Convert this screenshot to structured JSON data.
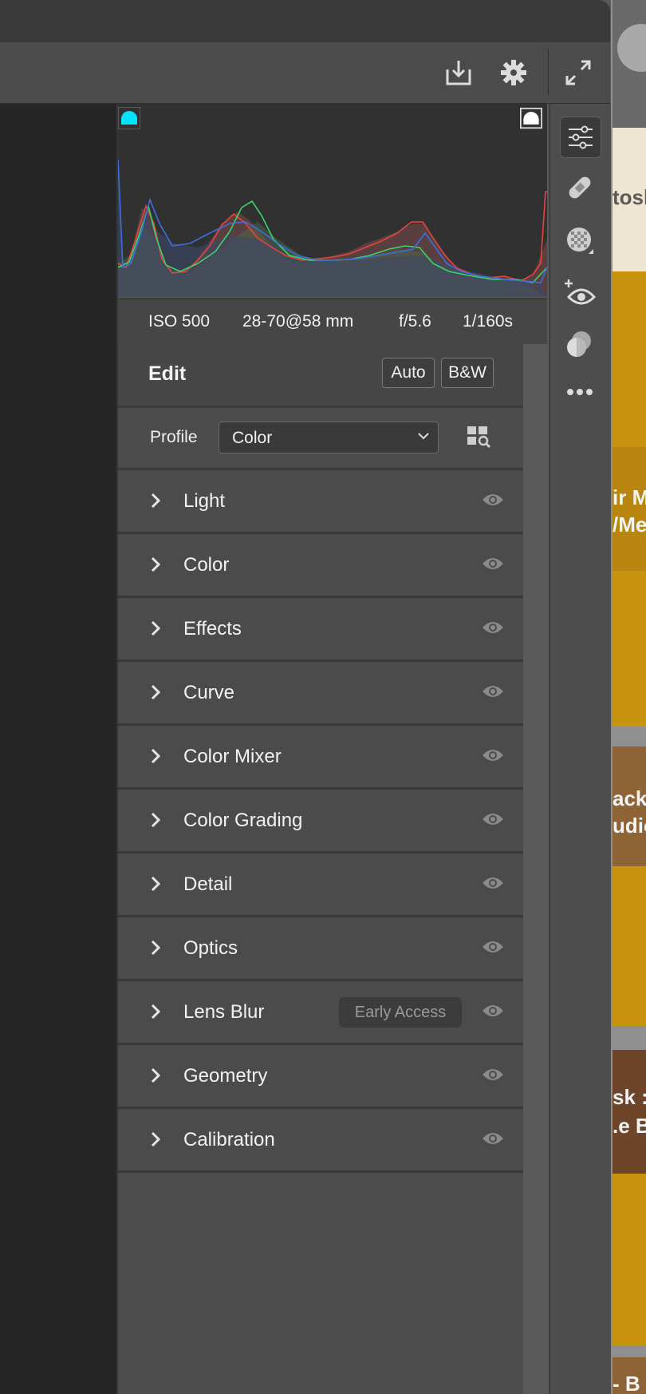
{
  "toolbar": {
    "icons": [
      "save-icon",
      "gear-icon",
      "fullscreen-icon"
    ]
  },
  "exif": {
    "iso": "ISO 500",
    "lens": "28-70@58 mm",
    "aperture": "f/5.6",
    "shutter": "1/160s"
  },
  "edit": {
    "title": "Edit",
    "auto_label": "Auto",
    "bw_label": "B&W"
  },
  "profile": {
    "label": "Profile",
    "value": "Color"
  },
  "sections": [
    {
      "label": "Light"
    },
    {
      "label": "Color"
    },
    {
      "label": "Effects"
    },
    {
      "label": "Curve"
    },
    {
      "label": "Color Mixer"
    },
    {
      "label": "Color Grading"
    },
    {
      "label": "Detail"
    },
    {
      "label": "Optics"
    },
    {
      "label": "Lens Blur",
      "badge": "Early Access"
    },
    {
      "label": "Geometry"
    },
    {
      "label": "Calibration"
    }
  ],
  "rail": [
    "edit-sliders-icon",
    "healing-bandage-icon",
    "masking-icon",
    "red-eye-icon",
    "presets-icon",
    "more-icon"
  ],
  "filmstrip": {
    "texts": [
      "tosh",
      "ir M",
      "/Me",
      "ack",
      "udic",
      "sk :",
      ".e B",
      "- B"
    ]
  },
  "colors": {
    "shadow_clip": "#00e5ff",
    "highlight_clip": "#ffffff",
    "red_channel": "#e8443c",
    "green_channel": "#3ad46a",
    "blue_channel": "#3b6fe0"
  }
}
